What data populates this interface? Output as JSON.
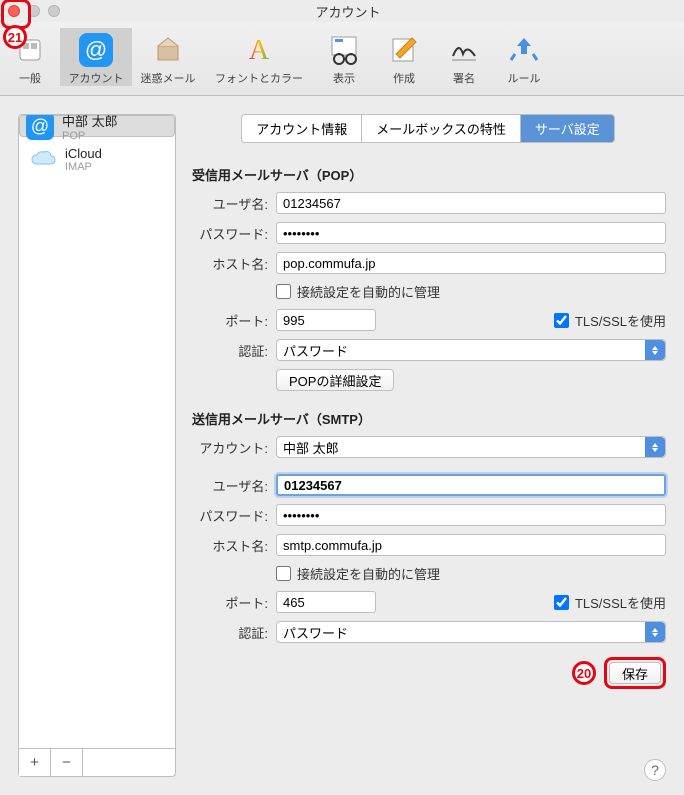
{
  "window": {
    "title": "アカウント"
  },
  "toolbar": {
    "general": "一般",
    "accounts": "アカウント",
    "junk": "迷惑メール",
    "fonts": "フォントとカラー",
    "viewing": "表示",
    "composing": "作成",
    "signatures": "署名",
    "rules": "ルール"
  },
  "sidebar": {
    "items": [
      {
        "name": "中部 太郎",
        "type": "POP"
      },
      {
        "name": "iCloud",
        "type": "IMAP"
      }
    ],
    "add": "+",
    "remove": "−"
  },
  "tabs": {
    "info": "アカウント情報",
    "mailbox": "メールボックスの特性",
    "server": "サーバ設定"
  },
  "incoming": {
    "title": "受信用メールサーバ（POP）",
    "user_label": "ユーザ名:",
    "user": "01234567",
    "pass_label": "パスワード:",
    "pass": "••••••••",
    "host_label": "ホスト名:",
    "host": "pop.commufa.jp",
    "auto": "接続設定を自動的に管理",
    "port_label": "ポート:",
    "port": "995",
    "tls": "TLS/SSLを使用",
    "auth_label": "認証:",
    "auth": "パスワード",
    "adv": "POPの詳細設定"
  },
  "outgoing": {
    "title": "送信用メールサーバ（SMTP）",
    "acct_label": "アカウント:",
    "acct": "中部 太郎",
    "user_label": "ユーザ名:",
    "user": "01234567",
    "pass_label": "パスワード:",
    "pass": "••••••••",
    "host_label": "ホスト名:",
    "host": "smtp.commufa.jp",
    "auto": "接続設定を自動的に管理",
    "port_label": "ポート:",
    "port": "465",
    "tls": "TLS/SSLを使用",
    "auth_label": "認証:",
    "auth": "パスワード"
  },
  "save": "保存",
  "help": "?",
  "callouts": {
    "save": "20",
    "close": "21"
  }
}
